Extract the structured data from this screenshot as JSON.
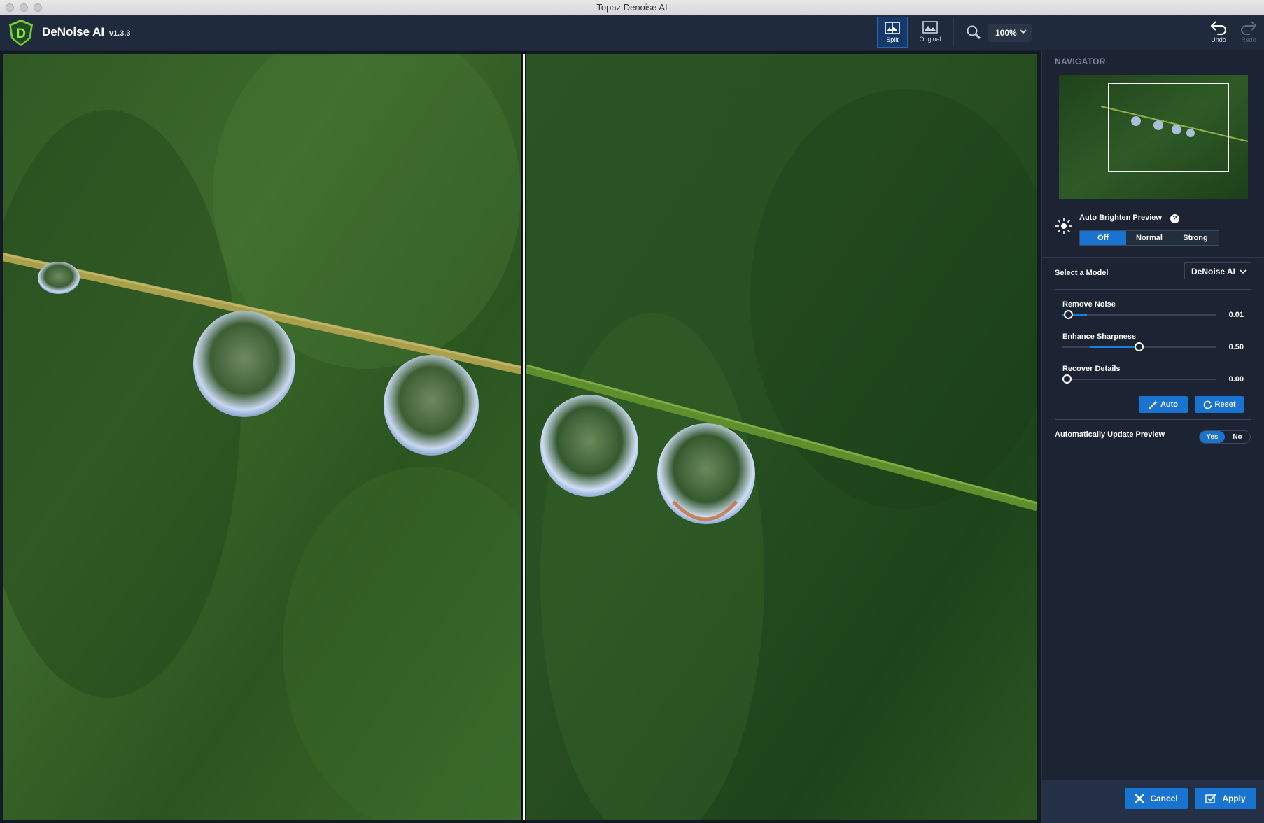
{
  "window": {
    "title": "Topaz Denoise AI"
  },
  "app": {
    "name": "DeNoise AI",
    "version": "v1.3.3"
  },
  "toolbar": {
    "split_label": "Split",
    "original_label": "Original",
    "zoom_value": "100%",
    "undo_label": "Undo",
    "redo_label": "Redo"
  },
  "panel": {
    "navigator_title": "NAVIGATOR",
    "auto_brighten": {
      "label": "Auto Brighten Preview",
      "help": "?",
      "options": [
        "Off",
        "Normal",
        "Strong"
      ],
      "selected": "Off"
    },
    "model": {
      "label": "Select a Model",
      "selected": "DeNoise AI"
    },
    "sliders": [
      {
        "label": "Remove Noise",
        "value": "0.01",
        "level": 0.01
      },
      {
        "label": "Enhance Sharpness",
        "value": "0.50",
        "level": 0.5
      },
      {
        "label": "Recover Details",
        "value": "0.00",
        "level": 0.0
      }
    ],
    "auto_label": "Auto",
    "reset_label": "Reset",
    "auto_update": {
      "label": "Automatically Update Preview",
      "yes": "Yes",
      "no": "No",
      "selected": "Yes"
    },
    "cancel_label": "Cancel",
    "apply_label": "Apply"
  },
  "colors": {
    "accent": "#1874d0",
    "toolbar_bg": "#1f2b3d",
    "panel_bg": "#1c2433"
  }
}
